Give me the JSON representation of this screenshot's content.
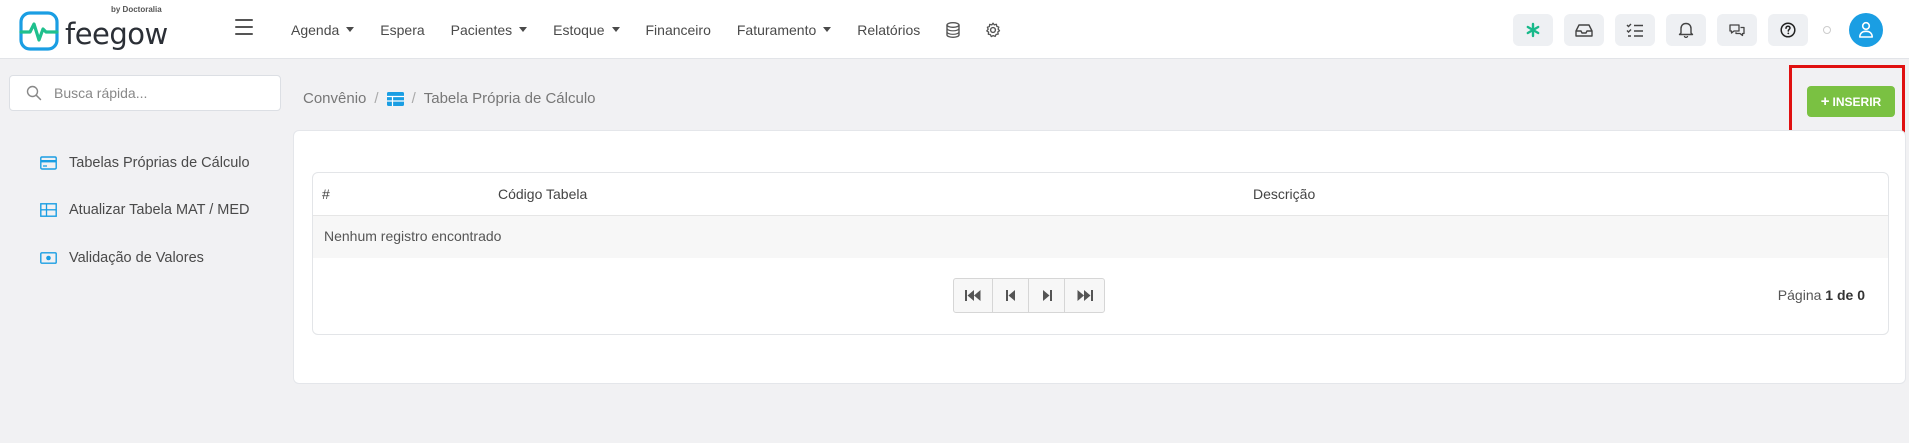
{
  "app": {
    "brand": "feegow",
    "brand_by": "by Doctoralia"
  },
  "nav": {
    "items": [
      {
        "label": "Agenda",
        "dropdown": true
      },
      {
        "label": "Espera",
        "dropdown": false
      },
      {
        "label": "Pacientes",
        "dropdown": true
      },
      {
        "label": "Estoque",
        "dropdown": true
      },
      {
        "label": "Financeiro",
        "dropdown": false
      },
      {
        "label": "Faturamento",
        "dropdown": true
      },
      {
        "label": "Relatórios",
        "dropdown": false
      }
    ],
    "icons": [
      "database-icon",
      "gear-icon"
    ]
  },
  "toolbar_icons": [
    "asterisk-icon",
    "inbox-icon",
    "checklist-icon",
    "bell-icon",
    "chat-icon",
    "help-icon"
  ],
  "colors": {
    "accent": "#1a9ee3",
    "insert_button": "#7ac142",
    "highlight_box": "#e01010",
    "asterisk_icon": "#18b98a"
  },
  "search": {
    "placeholder": "Busca rápida..."
  },
  "sidebar": {
    "items": [
      {
        "label": "Tabelas Próprias de Cálculo",
        "icon": "card-icon"
      },
      {
        "label": "Atualizar Tabela MAT / MED",
        "icon": "table-grid-icon"
      },
      {
        "label": "Validação de Valores",
        "icon": "money-icon"
      }
    ]
  },
  "breadcrumb": {
    "root": "Convênio",
    "separator": "/",
    "current": "Tabela Própria de Cálculo"
  },
  "actions": {
    "insert_label": "INSERIR",
    "insert_plus": "+"
  },
  "table": {
    "columns": [
      "#",
      "Código Tabela",
      "Descrição"
    ],
    "empty_message": "Nenhum registro encontrado"
  },
  "pagination": {
    "prefix": "Página",
    "current": "1",
    "of_label": "de",
    "total": "0"
  }
}
